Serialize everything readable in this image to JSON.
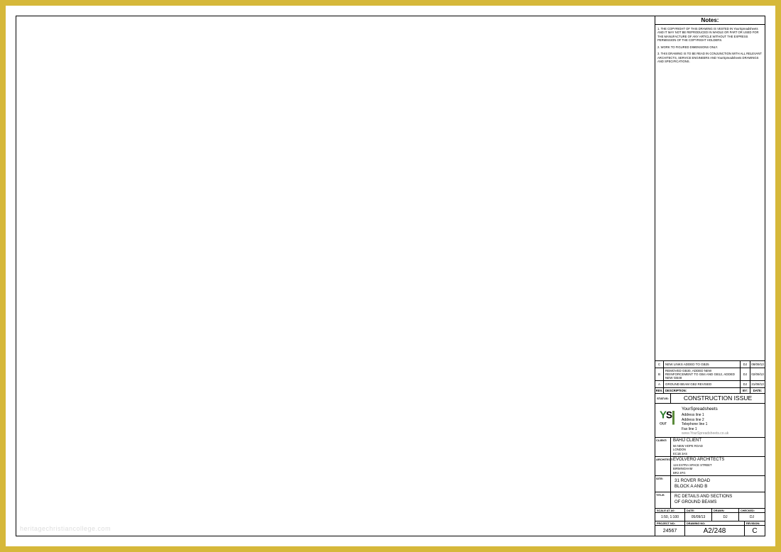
{
  "notes": {
    "heading": "Notes:",
    "n1": "1. THE COPYRIGHT OF THIS DRAWING IS VESTED IN YourSpreadsheets AND IT MAY NOT BE REPRODUCED IN WHOLE OR PART OR USED FOR THE MANUFACTURE OF ANY ARTICLE WITHOUT THE EXPRESS PERMISSION OF THE COPYRIGHT HOLDERS.",
    "n2": "2. WORK TO FIGURED DIMENSIONS ONLY.",
    "n3": "3. THIS DRAWING IS TO BE READ IN CONJUNCTION WITH ALL RELEVANT ARCHITECTS, SERVICE ENGINEERS AND YourSpreadsheets DRAWINGS AND SPECIFICATIONS."
  },
  "revisions": [
    {
      "rev": "C",
      "desc": "NEW LINKS ADDED TO GB25",
      "by": "DJ",
      "date": "08/09/13"
    },
    {
      "rev": "B",
      "desc": "REMOVED GB30, ADDED NEW REINFORCEMENT TO GB4 AND GB12, ADDED NEW GB48",
      "by": "DJ",
      "date": "02/09/13"
    },
    {
      "rev": "A",
      "desc": "GROUND BEAM GB2 REVISED",
      "by": "DJ",
      "date": "21/08/13"
    }
  ],
  "rev_header": {
    "rev": "REV.",
    "desc": "DESCRIPTION:",
    "by": "BY:",
    "date": "DATE:"
  },
  "status": {
    "label": "STATUS:",
    "value": "CONSTRUCTION ISSUE"
  },
  "company": {
    "name": "YourSpreadsheets",
    "addr1": "Address line 1",
    "addr2": "Address line 2",
    "tel": "Telephone line 1",
    "fax": "Fax line 1",
    "web": "www.YourSpreadsheets.co.uk"
  },
  "client": {
    "label": "CLIENT:",
    "name": "BAHIJ CLIENT",
    "addr1": "56 NEW HOPE ROAD",
    "addr2": "LONDON",
    "addr3": "EC1B 3AS"
  },
  "architect": {
    "label": "ARCHITECT:",
    "name": "EVOLVERO ARCHITECTS",
    "addr1": "124 EXTRA SPACE STREET",
    "addr2": "BIRMINGHAM",
    "addr3": "BR2 4FG"
  },
  "site": {
    "label": "SITE:",
    "line1": "31 ROVER ROAD",
    "line2": "BLOCK A AND B"
  },
  "title": {
    "label": "TITLE:",
    "line1": "RC DETAILS AND SECTIONS",
    "line2": "OF GROUND BEAMS"
  },
  "grid": {
    "scale_lbl": "SCALE AT A0:",
    "scale": "1:50, 1:100",
    "date_lbl": "DATE:",
    "date": "05/09/13",
    "drawn_lbl": "DRAWN:",
    "drawn": "DJ",
    "checked_lbl": "CHECKED:",
    "checked": "DJ"
  },
  "dwg": {
    "proj_lbl": "PROJECT NO:",
    "proj": "24567",
    "dwg_lbl": "DRAWING NO:",
    "dwg": "A2/248",
    "rev_lbl": "REVISION:",
    "rev": "C"
  },
  "watermark": "heritagechristiancollege.com"
}
